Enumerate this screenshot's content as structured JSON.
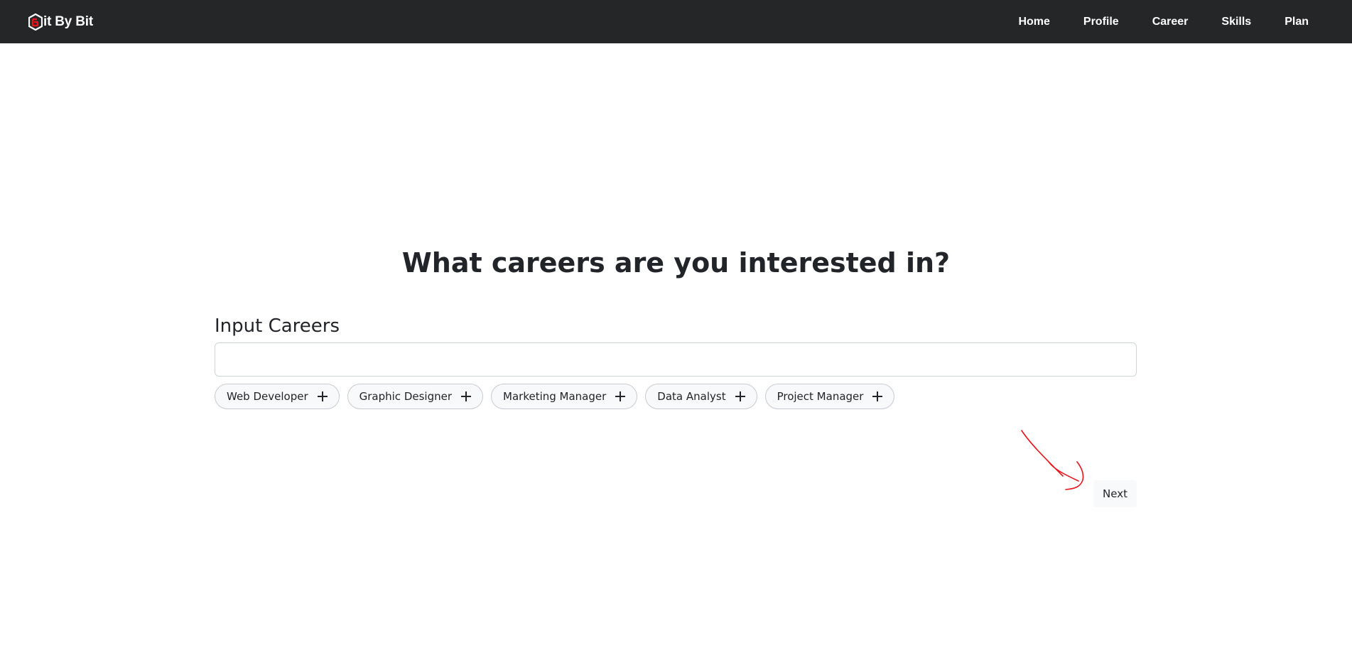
{
  "brand": {
    "name": "it By Bit",
    "icon": "bitbybit-logo-icon"
  },
  "nav": {
    "items": [
      {
        "label": "Home"
      },
      {
        "label": "Profile"
      },
      {
        "label": "Career"
      },
      {
        "label": "Skills"
      },
      {
        "label": "Plan"
      }
    ]
  },
  "main": {
    "heading": "What careers are you interested in?",
    "input_label": "Input Careers",
    "input_value": "",
    "input_placeholder": "",
    "suggestions": [
      {
        "label": "Web Developer",
        "icon": "plus-icon"
      },
      {
        "label": "Graphic Designer",
        "icon": "plus-icon"
      },
      {
        "label": "Marketing Manager",
        "icon": "plus-icon"
      },
      {
        "label": "Data Analyst",
        "icon": "plus-icon"
      },
      {
        "label": "Project Manager",
        "icon": "plus-icon"
      }
    ],
    "next_label": "Next"
  },
  "annotation": {
    "icon": "hand-drawn-arrow",
    "color": "#e8141c"
  },
  "colors": {
    "navbar_bg": "#252628",
    "brand_accent": "#e8141c",
    "chip_bg": "#f8f9fa",
    "text": "#212529"
  }
}
